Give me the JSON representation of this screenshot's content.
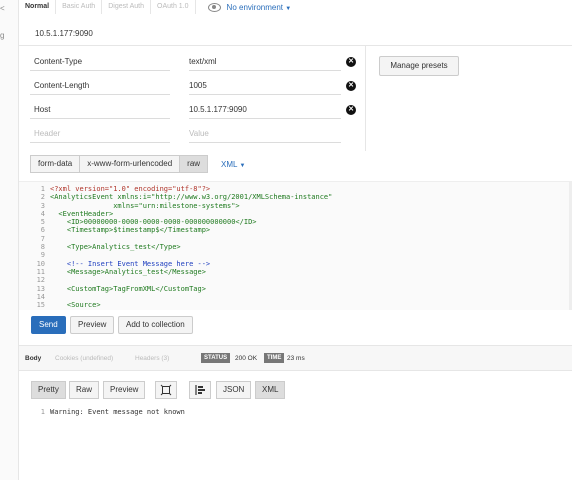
{
  "sidebar_marks": [
    "<",
    "g"
  ],
  "auth_tabs": [
    "Normal",
    "Basic Auth",
    "Digest Auth",
    "OAuth 1.0"
  ],
  "environment": "No environment",
  "url": "10.5.1.177:9090",
  "headers": [
    {
      "key": "Content-Type",
      "value": "text/xml"
    },
    {
      "key": "Content-Length",
      "value": "1005"
    },
    {
      "key": "Host",
      "value": "10.5.1.177:9090"
    }
  ],
  "header_placeholder": {
    "key": "Header",
    "value": "Value"
  },
  "manage_presets": "Manage presets",
  "body_tabs": [
    "form-data",
    "x-www-form-urlencoded",
    "raw"
  ],
  "body_format": "XML",
  "code_line_numbers": [
    "1",
    "2",
    "3",
    "4",
    "5",
    "6",
    "7",
    "8",
    "9",
    "10",
    "11",
    "12",
    "13",
    "14",
    "15"
  ],
  "code_lines": [
    "<?xml version=\"1.0\" encoding=\"utf-8\"?>",
    "<AnalyticsEvent xmlns:i=\"http://www.w3.org/2001/XMLSchema-instance\"",
    "               xmlns=\"urn:milestone-systems\">",
    "  <EventHeader>",
    "    <ID>00000000-0000-0000-0000-000000000000</ID>",
    "    <Timestamp>$timestamp$</Timestamp>",
    "",
    "    <Type>Analytics_test</Type>",
    "",
    "    <!-- Insert Event Message here -->",
    "    <Message>Analytics_test</Message>",
    "",
    "    <CustomTag>TagFromXML</CustomTag>",
    "",
    "    <Source>"
  ],
  "actions": {
    "send": "Send",
    "preview": "Preview",
    "add_to_collection": "Add to collection"
  },
  "response_tabs": [
    "Body",
    "Cookies (undefined)",
    "Headers (3)"
  ],
  "status_label": "STATUS",
  "status_value": "200 OK",
  "time_label": "TIME",
  "time_value": "23 ms",
  "view_modes": [
    "Pretty",
    "Raw",
    "Preview"
  ],
  "format_buttons": [
    "JSON",
    "XML"
  ],
  "response_line_number": "1",
  "response_text": "Warning: Event message not known",
  "colors": {
    "accent": "#2a6ebb",
    "xml_tag": "#1f7a1f",
    "xml_string": "#1f3fbf",
    "xml_decl": "#b0352b"
  }
}
